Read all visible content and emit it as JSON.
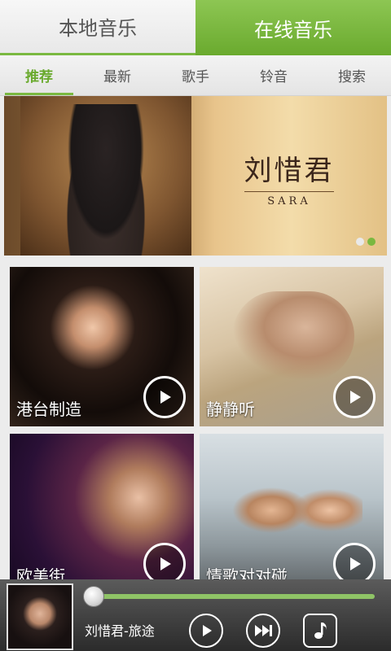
{
  "top_tabs": [
    {
      "label": "本地音乐",
      "active": false
    },
    {
      "label": "在线音乐",
      "active": true
    }
  ],
  "subnav": [
    {
      "label": "推荐",
      "active": true
    },
    {
      "label": "最新",
      "active": false
    },
    {
      "label": "歌手",
      "active": false
    },
    {
      "label": "铃音",
      "active": false
    },
    {
      "label": "搜索",
      "active": false
    }
  ],
  "banner": {
    "title": "刘惜君",
    "subtitle": "SARA",
    "page_count": 2,
    "current_page": 2
  },
  "tiles": [
    {
      "label": "港台制造",
      "icon": "play-icon"
    },
    {
      "label": "静静听",
      "icon": "play-icon"
    },
    {
      "label": "欧美街",
      "icon": "play-icon"
    },
    {
      "label": "情歌对对碰",
      "icon": "play-icon"
    }
  ],
  "player": {
    "now_playing": "刘惜君-旅途",
    "progress_percent": 0,
    "controls": [
      "play-icon",
      "next-icon",
      "music-note-icon"
    ]
  },
  "colors": {
    "accent": "#7ab840",
    "online_tab_bg": "#6aaa2e",
    "player_bg": "#2b2b2b"
  }
}
